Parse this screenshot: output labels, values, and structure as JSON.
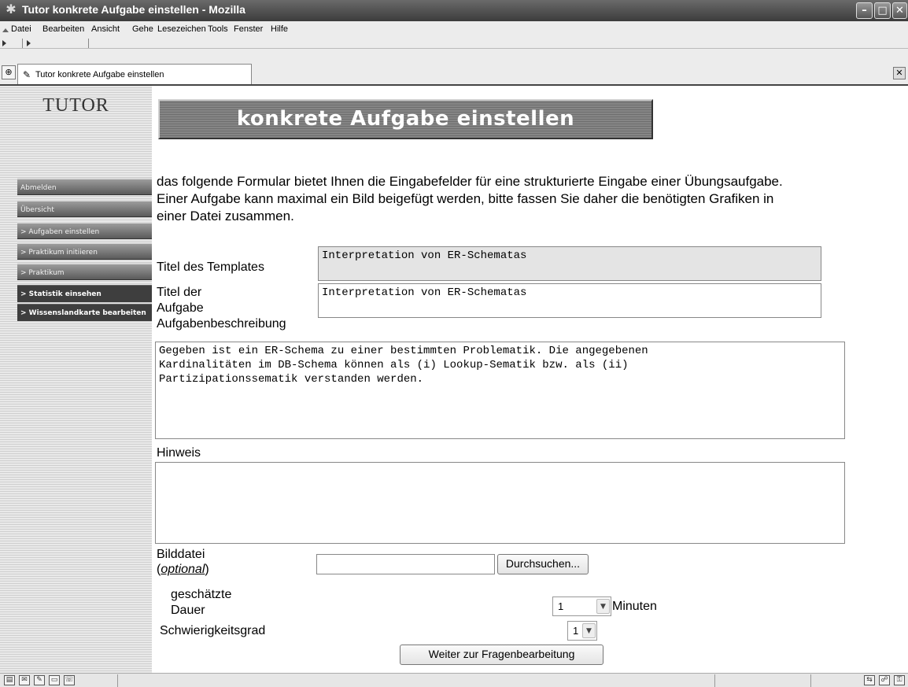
{
  "window": {
    "title": "Tutor konkrete Aufgabe einstellen - Mozilla",
    "minimize": "–",
    "maximize": "□",
    "close": "✕"
  },
  "menu": [
    "Datei",
    "Bearbeiten",
    "Ansicht",
    "Gehe",
    "Lesezeichen",
    "Tools",
    "Fenster",
    "Hilfe"
  ],
  "tab": {
    "label": "Tutor konkrete Aufgabe einstellen",
    "close": "✕"
  },
  "sidebar": {
    "logo": "TUTOR",
    "items": [
      {
        "label": "Abmelden"
      },
      {
        "label": "Übersicht"
      },
      {
        "label": "> Aufgaben einstellen"
      },
      {
        "label": "> Praktikum initiieren"
      },
      {
        "label": "> Praktikum"
      },
      {
        "label": "> Statistik einsehen"
      },
      {
        "label": "> Wissenslandkarte bearbeiten"
      }
    ]
  },
  "page": {
    "heading": "konkrete Aufgabe einstellen",
    "intro": "das folgende Formular bietet Ihnen die Eingabefelder für eine strukturierte Eingabe einer Übungsaufgabe. Einer Aufgabe kann maximal ein Bild beigefügt werden, bitte fassen Sie daher die benötigten Grafiken in einer Datei zusammen."
  },
  "form": {
    "template_title": {
      "label": "Titel des Templates",
      "value": "Interpretation von ER-Schematas"
    },
    "task_title": {
      "label_line1": "Titel der",
      "label_line2": "Aufgabe",
      "value": "Interpretation von ER-Schematas"
    },
    "description": {
      "label": "Aufgabenbeschreibung",
      "value": "Gegeben ist ein ER-Schema zu einer bestimmten Problematik. Die angegebenen\nKardinalitäten im DB-Schema können als (i) Lookup-Sematik bzw. als (ii)\nPartizipationssematik verstanden werden."
    },
    "hint": {
      "label": "Hinweis",
      "value": ""
    },
    "image": {
      "label": "Bilddatei",
      "optional": "optional",
      "value": "",
      "browse_label": "Durchsuchen..."
    },
    "duration": {
      "label_line1": "geschätzte",
      "label_line2": "Dauer",
      "value": "1",
      "unit": "Minuten"
    },
    "difficulty": {
      "label": "Schwierigkeitsgrad",
      "value": "1"
    },
    "submit_label": "Weiter zur Fragenbearbeitung"
  }
}
